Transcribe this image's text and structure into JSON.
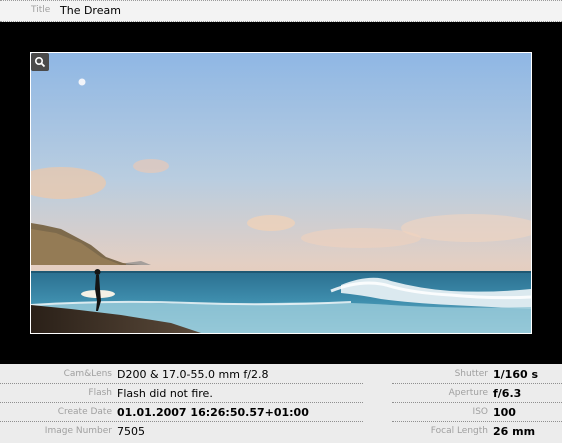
{
  "title": {
    "label": "Title",
    "value": "The Dream"
  },
  "viewer": {
    "zoom_icon": "magnifier-icon",
    "background": "#000000"
  },
  "metadata": {
    "left": [
      {
        "key": "Cam&Lens",
        "value": "D200 & 17.0-55.0 mm f/2.8"
      },
      {
        "key": "Flash",
        "value": "Flash did not fire."
      },
      {
        "key": "Create Date",
        "value": "01.01.2007 16:26:50.57+01:00"
      },
      {
        "key": "Image Number",
        "value": "7505"
      }
    ],
    "right": [
      {
        "key": "Shutter",
        "value": "1/160 s"
      },
      {
        "key": "Aperture",
        "value": "f/6.3"
      },
      {
        "key": "ISO",
        "value": "100"
      },
      {
        "key": "Focal Length",
        "value": "26 mm"
      }
    ]
  }
}
